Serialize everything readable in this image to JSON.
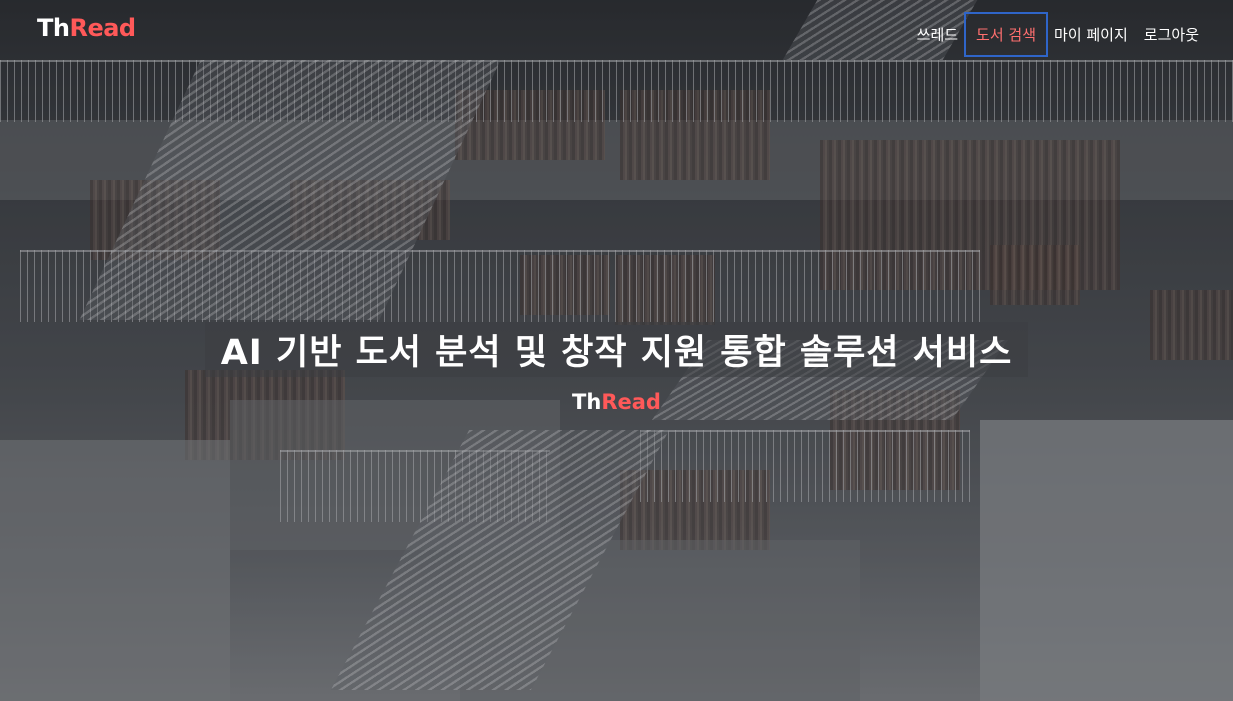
{
  "brand": {
    "logo_part1": "Th",
    "logo_part2": "Read"
  },
  "nav": {
    "items": [
      {
        "label": "쓰레드"
      },
      {
        "label": "도서 검색"
      },
      {
        "label": "마이 페이지"
      },
      {
        "label": "로그아웃"
      }
    ],
    "active_index": 1
  },
  "hero": {
    "title": "AI 기반 도서 분석 및 창작 지원 통합 솔루션 서비스",
    "subtitle_part1": "Th",
    "subtitle_part2": "Read"
  },
  "colors": {
    "accent": "#ff5959",
    "active_outline": "#2f65c9",
    "text": "#ffffff"
  }
}
